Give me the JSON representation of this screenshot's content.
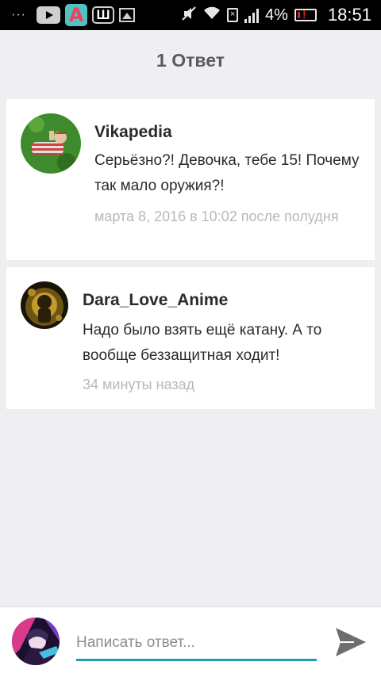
{
  "status_bar": {
    "dots": "···",
    "shortcut_letter": "Ш",
    "amino_letter": "A",
    "battery_percent": "4%",
    "time": "18:51"
  },
  "header": {
    "title": "1 Ответ"
  },
  "comments": [
    {
      "username": "Vikapedia",
      "text": "Серьёзно?! Девочка, тебе 15! Почему так мало оружия?!",
      "time": "марта 8, 2016 в 10:02 после полудня"
    },
    {
      "username": "Dara_Love_Anime",
      "text": "Надо было взять ещё катану. А то вообще беззащитная ходит!",
      "time": "34 минуты назад"
    }
  ],
  "compose": {
    "placeholder": "Написать ответ..."
  },
  "colors": {
    "accent": "#1f9bb3",
    "background": "#efeef1"
  }
}
